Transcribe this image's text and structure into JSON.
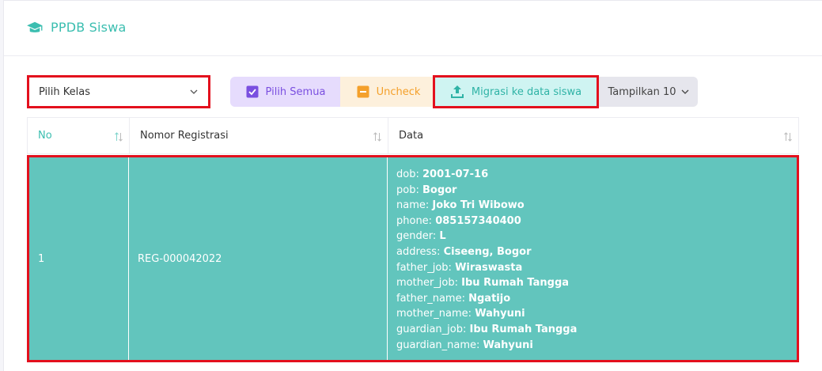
{
  "header": {
    "title": "PPDB Siswa",
    "icon": "graduation-cap-icon"
  },
  "filter": {
    "select_value": "Pilih Kelas"
  },
  "toolbar": {
    "pilih_semua": "Pilih Semua",
    "uncheck": "Uncheck",
    "migrasi": "Migrasi ke data siswa",
    "tampilkan": "Tampilkan 10"
  },
  "table": {
    "columns": [
      "No",
      "Nomor Registrasi",
      "Data"
    ],
    "rows": [
      {
        "no": "1",
        "reg": "REG-000042022",
        "data": [
          {
            "key": "dob: ",
            "value": "2001-07-16"
          },
          {
            "key": "pob: ",
            "value": "Bogor"
          },
          {
            "key": "name: ",
            "value": "Joko Tri Wibowo"
          },
          {
            "key": "phone: ",
            "value": "085157340400"
          },
          {
            "key": "gender: ",
            "value": "L"
          },
          {
            "key": "address: ",
            "value": "Ciseeng, Bogor"
          },
          {
            "key": "father_job: ",
            "value": "Wiraswasta"
          },
          {
            "key": "mother_job: ",
            "value": "Ibu Rumah Tangga"
          },
          {
            "key": "father_name: ",
            "value": "Ngatijo"
          },
          {
            "key": "mother_name: ",
            "value": "Wahyuni"
          },
          {
            "key": "guardian_job: ",
            "value": "Ibu Rumah Tangga"
          },
          {
            "key": "guardian_name: ",
            "value": "Wahyuni"
          }
        ]
      }
    ]
  },
  "colors": {
    "accent": "#3bbeb0",
    "row_selected": "#62c5bd",
    "highlight_border": "#e3101d"
  }
}
